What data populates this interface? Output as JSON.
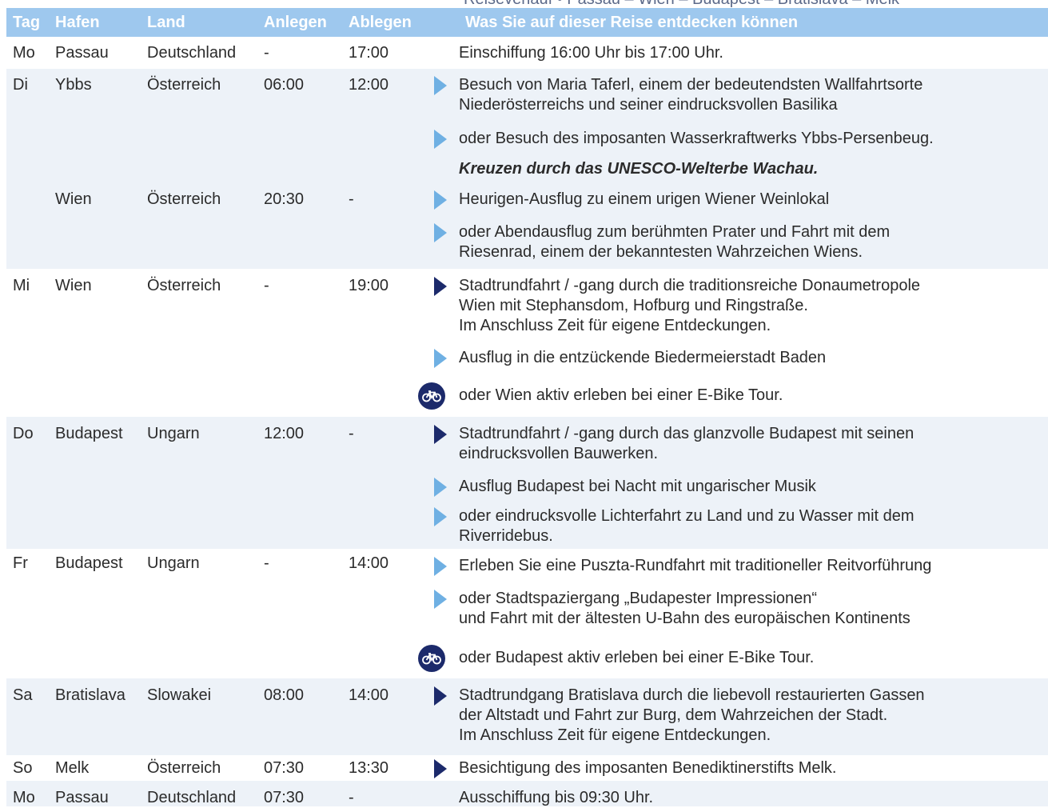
{
  "top_text": "Reiseverlauf • Passau – Wien – Budapest – Bratislava – Melk",
  "colors": {
    "header_bg": "#9ec8ee",
    "row_shade": "#edf2f8",
    "arrow_light": "#6fb0e3",
    "arrow_dark": "#1c2a6b",
    "bike_bg": "#1c2a6b"
  },
  "headers": {
    "tag": "Tag",
    "hafen": "Hafen",
    "land": "Land",
    "anlegen": "Anlegen",
    "ablegen": "Ablegen",
    "entdecken": "Was Sie auf dieser Reise entdecken können"
  },
  "rows": [
    {
      "tag": "Mo",
      "hafen": "Passau",
      "land": "Deutschland",
      "anlegen": "-",
      "ablegen": "17:00",
      "activities": [
        {
          "text": "Einschiffung 16:00 Uhr bis 17:00 Uhr.",
          "icon": "none"
        }
      ]
    },
    {
      "tag": "Di",
      "hafen": "Ybbs",
      "land": "Österreich",
      "anlegen": "06:00",
      "ablegen": "12:00",
      "activities": [
        {
          "text": "Besuch von Maria Taferl, einem der bedeutendsten Wallfahrtsorte\nNiederösterreichs und seiner eindrucksvollen Basilika",
          "icon": "arrow-light"
        },
        {
          "text": "oder Besuch des imposanten Wasserkraftwerks Ybbs-Persenbeug.",
          "icon": "arrow-light"
        },
        {
          "text": "Kreuzen durch das UNESCO-Welterbe Wachau.",
          "icon": "none"
        }
      ]
    },
    {
      "tag": "",
      "hafen": "Wien",
      "land": "Österreich",
      "anlegen": "20:30",
      "ablegen": "-",
      "activities": [
        {
          "text": "Heurigen-Ausflug zu einem urigen Wiener Weinlokal",
          "icon": "arrow-light"
        },
        {
          "text": "oder Abendausflug zum berühmten Prater und Fahrt mit dem\nRiesenrad, einem der bekanntesten Wahrzeichen Wiens.",
          "icon": "arrow-light"
        }
      ]
    },
    {
      "tag": "Mi",
      "hafen": "Wien",
      "land": "Österreich",
      "anlegen": "-",
      "ablegen": "19:00",
      "activities": [
        {
          "text": "Stadtrundfahrt / -gang durch die traditionsreiche Donaumetropole\nWien mit Stephansdom, Hofburg und Ringstraße.\nIm Anschluss Zeit für eigene Entdeckungen.",
          "icon": "arrow-dark"
        },
        {
          "text": "Ausflug in die entzückende Biedermeierstadt Baden",
          "icon": "arrow-light"
        },
        {
          "text": "oder Wien aktiv erleben bei einer E-Bike Tour.",
          "icon": "bike"
        }
      ]
    },
    {
      "tag": "Do",
      "hafen": "Budapest",
      "land": "Ungarn",
      "anlegen": "12:00",
      "ablegen": "-",
      "activities": [
        {
          "text": "Stadtrundfahrt / -gang durch das glanzvolle Budapest mit seinen\neindrucksvollen Bauwerken.",
          "icon": "arrow-dark"
        },
        {
          "text": "Ausflug Budapest bei Nacht mit ungarischer Musik",
          "icon": "arrow-light"
        },
        {
          "text": "oder eindrucksvolle Lichterfahrt zu Land und zu Wasser mit dem\nRiverridebus.",
          "icon": "arrow-light"
        }
      ]
    },
    {
      "tag": "Fr",
      "hafen": "Budapest",
      "land": "Ungarn",
      "anlegen": "-",
      "ablegen": "14:00",
      "activities": [
        {
          "text": "Erleben Sie eine Puszta-Rundfahrt mit traditioneller Reitvorführung",
          "icon": "arrow-light"
        },
        {
          "text": "oder Stadtspaziergang „Budapester Impressionen“\nund Fahrt mit der ältesten U-Bahn des europäischen Kontinents",
          "icon": "arrow-light"
        },
        {
          "text": "oder Budapest aktiv erleben bei einer E-Bike Tour.",
          "icon": "bike"
        }
      ]
    },
    {
      "tag": "Sa",
      "hafen": "Bratislava",
      "land": "Slowakei",
      "anlegen": "08:00",
      "ablegen": "14:00",
      "activities": [
        {
          "text": "Stadtrundgang Bratislava durch die liebevoll restaurierten Gassen\nder Altstadt und Fahrt zur Burg, dem Wahrzeichen der Stadt.\nIm Anschluss Zeit für eigene Entdeckungen.",
          "icon": "arrow-dark"
        }
      ]
    },
    {
      "tag": "So",
      "hafen": "Melk",
      "land": "Österreich",
      "anlegen": "07:30",
      "ablegen": "13:30",
      "activities": [
        {
          "text": "Besichtigung des imposanten Benediktinerstifts Melk.",
          "icon": "arrow-dark"
        }
      ]
    },
    {
      "tag": "Mo",
      "hafen": "Passau",
      "land": "Deutschland",
      "anlegen": "07:30",
      "ablegen": "-",
      "activities": [
        {
          "text": "Ausschiffung bis 09:30 Uhr.",
          "icon": "none"
        }
      ]
    }
  ]
}
